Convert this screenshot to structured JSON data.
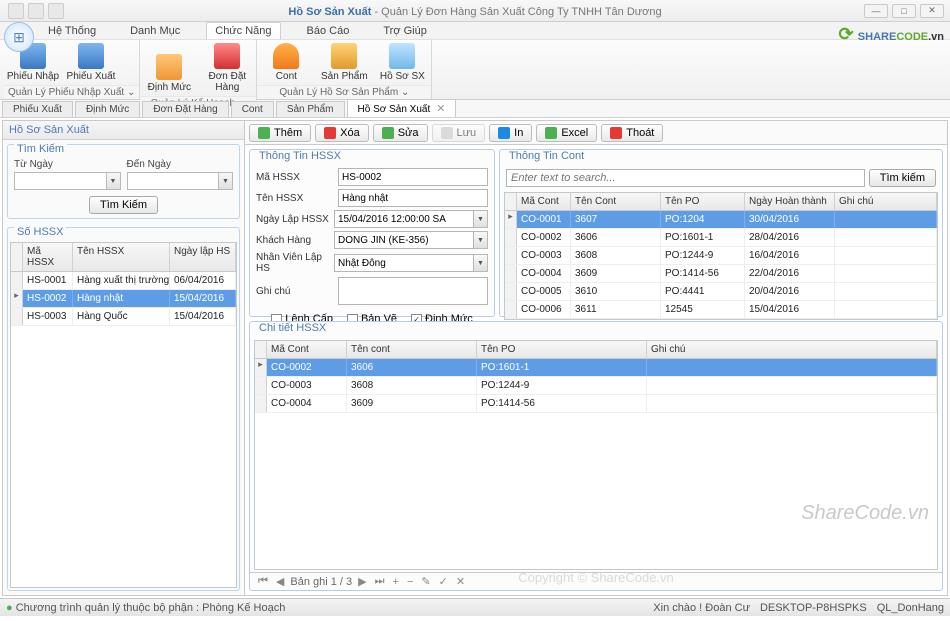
{
  "window": {
    "title_strong": "Hồ Sơ Sản Xuất",
    "title_rest": " - Quản Lý Đơn Hàng Sản Xuất Công Ty TNHH Tân Dương"
  },
  "logo": {
    "pre": "SHARE",
    "mid": "CODE",
    "suf": ".vn"
  },
  "menu": {
    "items": [
      "Hệ Thống",
      "Danh Mục",
      "Chức Năng",
      "Báo Cáo",
      "Trợ Giúp"
    ],
    "active": "Chức Năng"
  },
  "ribbon": {
    "groups": [
      {
        "title": "Quản Lý Phiếu Nhập Xuất",
        "buttons": [
          {
            "label": "Phiếu Nhập"
          },
          {
            "label": "Phiếu Xuất"
          }
        ]
      },
      {
        "title": "Quản Lý Kế Hoạch",
        "buttons": [
          {
            "label": "Định Mức"
          },
          {
            "label": "Đơn Đặt Hàng"
          }
        ]
      },
      {
        "title": "Quản Lý Hồ Sơ Sản Phẩm",
        "buttons": [
          {
            "label": "Cont"
          },
          {
            "label": "Sản Phẩm"
          },
          {
            "label": "Hồ Sơ SX"
          }
        ]
      }
    ]
  },
  "doctabs": [
    "Phiếu Xuất",
    "Định Mức",
    "Đơn Đặt Hàng",
    "Cont",
    "Sản Phẩm",
    "Hồ Sơ Sản Xuất"
  ],
  "active_doctab": "Hồ Sơ Sản Xuất",
  "left": {
    "title": "Hồ Sơ Sản Xuất",
    "search": {
      "title": "Tìm Kiếm",
      "from": "Từ Ngày",
      "to": "Đến Ngày",
      "btn": "Tìm Kiếm"
    },
    "list": {
      "title": "Số HSSX",
      "cols": [
        "Mã HSSX",
        "Tên HSSX",
        "Ngày lập HS"
      ],
      "rows": [
        {
          "ma": "HS-0001",
          "ten": "Hàng xuất thị trường Mỹ",
          "ngay": "06/04/2016",
          "sel": false
        },
        {
          "ma": "HS-0002",
          "ten": "Hàng nhật",
          "ngay": "15/04/2016",
          "sel": true
        },
        {
          "ma": "HS-0003",
          "ten": "Hàng Quốc",
          "ngay": "15/04/2016",
          "sel": false
        }
      ]
    }
  },
  "toolbar": {
    "add": "Thêm",
    "del": "Xóa",
    "edit": "Sửa",
    "save": "Lưu",
    "print": "In",
    "excel": "Excel",
    "exit": "Thoát"
  },
  "info_hssx": {
    "title": "Thông Tin HSSX",
    "labels": {
      "ma": "Mã HSSX",
      "ten": "Tên HSSX",
      "ngay": "Ngày Lập HSSX",
      "kh": "Khách Hàng",
      "nv": "Nhân Viên Lập HS",
      "ghichu": "Ghi chú"
    },
    "values": {
      "ma": "HS-0002",
      "ten": "Hàng nhật",
      "ngay": "15/04/2016 12:00:00 SA",
      "kh": "DONG JIN (KE-356)",
      "nv": "Nhật Đông",
      "ghichu": ""
    },
    "checks": {
      "lenhcap": "Lệnh Cấp",
      "banve": "Bản Vẽ",
      "dinhmuc": "Định Mức"
    }
  },
  "info_cont": {
    "title": "Thông Tin Cont",
    "search_placeholder": "Enter text to search...",
    "search_btn": "Tìm kiếm",
    "cols": [
      "Mã Cont",
      "Tên Cont",
      "Tên PO",
      "Ngày Hoàn thành",
      "Ghi chú"
    ],
    "rows": [
      {
        "ma": "CO-0001",
        "ten": "3607",
        "po": "PO:1204",
        "ngay": "30/04/2016",
        "gc": "",
        "sel": true
      },
      {
        "ma": "CO-0002",
        "ten": "3606",
        "po": "PO:1601-1",
        "ngay": "28/04/2016",
        "gc": "",
        "sel": false
      },
      {
        "ma": "CO-0003",
        "ten": "3608",
        "po": "PO:1244-9",
        "ngay": "16/04/2016",
        "gc": "",
        "sel": false
      },
      {
        "ma": "CO-0004",
        "ten": "3609",
        "po": "PO:1414-56",
        "ngay": "22/04/2016",
        "gc": "",
        "sel": false
      },
      {
        "ma": "CO-0005",
        "ten": "3610",
        "po": "PO:4441",
        "ngay": "20/04/2016",
        "gc": "",
        "sel": false
      },
      {
        "ma": "CO-0006",
        "ten": "3611",
        "po": "12545",
        "ngay": "15/04/2016",
        "gc": "",
        "sel": false
      }
    ]
  },
  "detail": {
    "title": "Chi tiết HSSX",
    "cols": [
      "Mã Cont",
      "Tên cont",
      "Tên PO",
      "Ghi chú"
    ],
    "rows": [
      {
        "ma": "CO-0002",
        "ten": "3606",
        "po": "PO:1601-1",
        "gc": "",
        "sel": true
      },
      {
        "ma": "CO-0003",
        "ten": "3608",
        "po": "PO:1244-9",
        "gc": "",
        "sel": false
      },
      {
        "ma": "CO-0004",
        "ten": "3609",
        "po": "PO:1414-56",
        "gc": "",
        "sel": false
      }
    ],
    "pager": "Bản ghi 1 / 3"
  },
  "watermark1": "ShareCode.vn",
  "watermark2": "Copyright © ShareCode.vn",
  "statusbar": {
    "left": "Chương trình quản lý thuộc bộ phận : Phòng Kế Hoạch",
    "greet": "Xin chào ! Đoàn Cư",
    "host": "DESKTOP-P8HSPKS",
    "db": "QL_DonHang"
  }
}
